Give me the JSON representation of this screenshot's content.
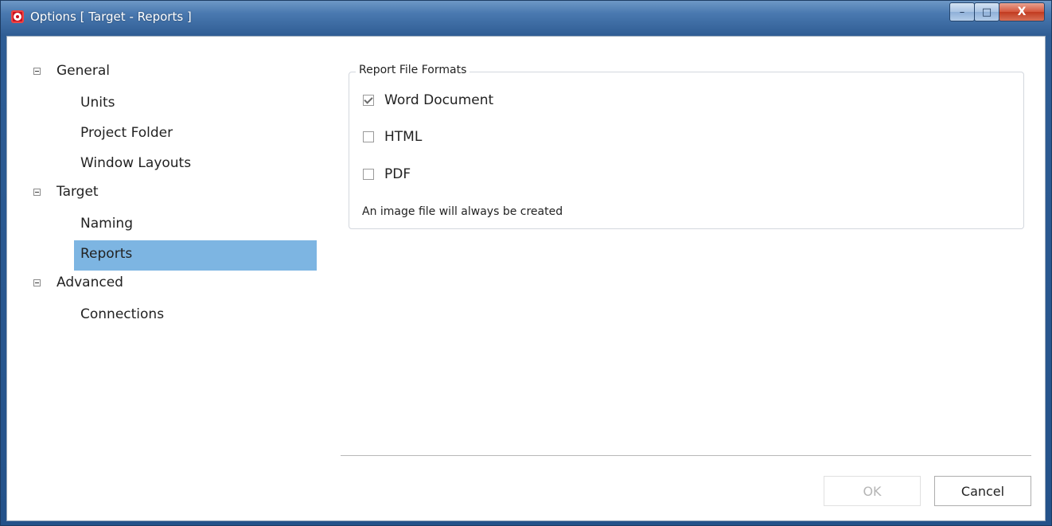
{
  "window": {
    "title": "Options [ Target - Reports ]",
    "minimize_glyph": "–",
    "maximize_glyph": "□",
    "close_glyph": "X"
  },
  "nav": {
    "groups": [
      {
        "label": "General",
        "items": [
          "Units",
          "Project Folder",
          "Window Layouts"
        ]
      },
      {
        "label": "Target",
        "items": [
          "Naming",
          "Reports"
        ]
      },
      {
        "label": "Advanced",
        "items": [
          "Connections"
        ]
      }
    ],
    "selected": "Reports"
  },
  "report_formats": {
    "title": "Report File Formats",
    "options": [
      {
        "label": "Word Document",
        "checked": true
      },
      {
        "label": "HTML",
        "checked": false
      },
      {
        "label": "PDF",
        "checked": false
      }
    ],
    "note": "An image file will always be created"
  },
  "buttons": {
    "ok_label": "OK",
    "ok_enabled": false,
    "cancel_label": "Cancel"
  },
  "colors": {
    "selection": "#7db5e2",
    "title_bar": "#2f5d94"
  }
}
